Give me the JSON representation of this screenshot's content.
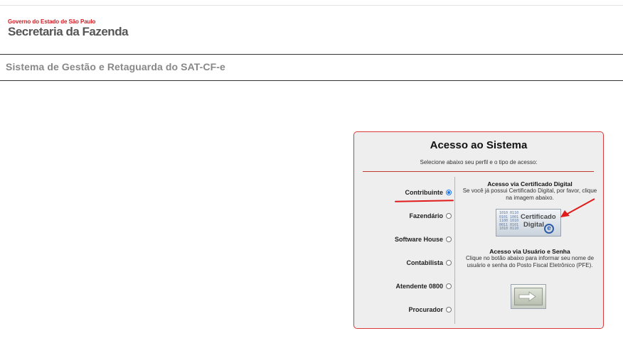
{
  "header": {
    "gov_line": "Governo do Estado de São Paulo",
    "agency_name": "Secretaria da Fazenda"
  },
  "system": {
    "title": "Sistema de Gestão e Retaguarda do SAT-CF-e"
  },
  "access_panel": {
    "title": "Acesso ao Sistema",
    "subtitle": "Selecione abaixo seu perfil e o tipo de acesso:",
    "profiles": [
      {
        "label": "Contribuinte",
        "selected": true
      },
      {
        "label": "Fazendário",
        "selected": false
      },
      {
        "label": "Software House",
        "selected": false
      },
      {
        "label": "Contabilista",
        "selected": false
      },
      {
        "label": "Atendente 0800",
        "selected": false
      },
      {
        "label": "Procurador",
        "selected": false
      }
    ],
    "cert_section": {
      "title": "Acesso via Certificado Digital",
      "text": "Se você já possui Certificado Digital, por favor, clique na imagem abaixo.",
      "button_line1": "Certificado",
      "button_line2": "Digital",
      "button_icon": "e"
    },
    "user_section": {
      "title": "Acesso via Usuário e Senha",
      "text": "Clique no botão abaixo para informar seu nome de usuário e senha do Posto Fiscal Eletrônico (PFE)."
    }
  },
  "colors": {
    "accent_red": "#d71920",
    "panel_border": "#d93b3b",
    "radio_selected": "#1a73e8"
  }
}
